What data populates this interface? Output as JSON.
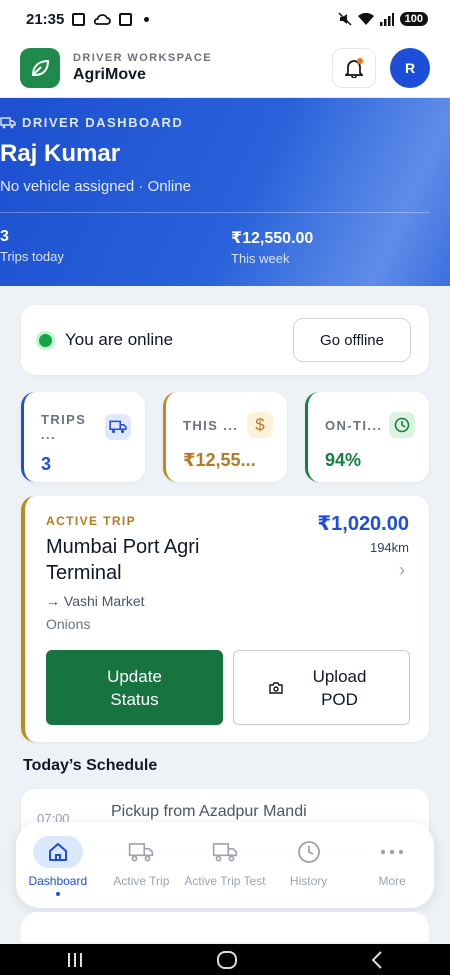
{
  "status_bar": {
    "time": "21:35",
    "battery": "100"
  },
  "header": {
    "subtitle": "DRIVER WORKSPACE",
    "app_name": "AgriMove",
    "avatar_initial": "R"
  },
  "hero": {
    "eyebrow": "DRIVER DASHBOARD",
    "driver_name": "Raj Kumar",
    "status_line": "No vehicle assigned · Online",
    "stats": [
      {
        "value": "3",
        "label": "Trips today"
      },
      {
        "value": "₹12,550.00",
        "label": "This week"
      }
    ]
  },
  "online_card": {
    "status_text": "You are online",
    "button_label": "Go offline"
  },
  "stat_cards": [
    {
      "label": "TRIPS ...",
      "value": "3",
      "accent": "#1d4ed8",
      "icon": "truck-icon"
    },
    {
      "label": "THIS ...",
      "value": "₹12,55...",
      "accent": "#c48a17",
      "icon": "dollar-icon"
    },
    {
      "label": "ON-TI...",
      "value": "94%",
      "accent": "#15803d",
      "icon": "clock-icon"
    }
  ],
  "active_trip": {
    "eyebrow": "ACTIVE TRIP",
    "origin": "Mumbai Port Agri Terminal",
    "amount": "₹1,020.00",
    "distance": "194km",
    "destination": "→ Vashi Market",
    "crop": "Onions",
    "primary_button": "Update Status",
    "secondary_button": "Upload POD"
  },
  "schedule": {
    "title": "Today’s Schedule",
    "items": [
      {
        "time": "07:00",
        "title": "Pickup from Azadpur Mandi"
      }
    ]
  },
  "bottom_nav": [
    {
      "label": "Dashboard",
      "icon": "home-icon",
      "active": true
    },
    {
      "label": "Active Trip",
      "icon": "truck-icon",
      "active": false
    },
    {
      "label": "Active Trip Test",
      "icon": "truck-icon",
      "active": false
    },
    {
      "label": "History",
      "icon": "clock-icon",
      "active": false
    },
    {
      "label": "More",
      "icon": "more-icon",
      "active": false
    }
  ],
  "colors": {
    "primary": "#1d4ed8",
    "brand_green": "#1f8a4c",
    "accent_gold": "#c48a17",
    "online_green": "#16a34a"
  }
}
